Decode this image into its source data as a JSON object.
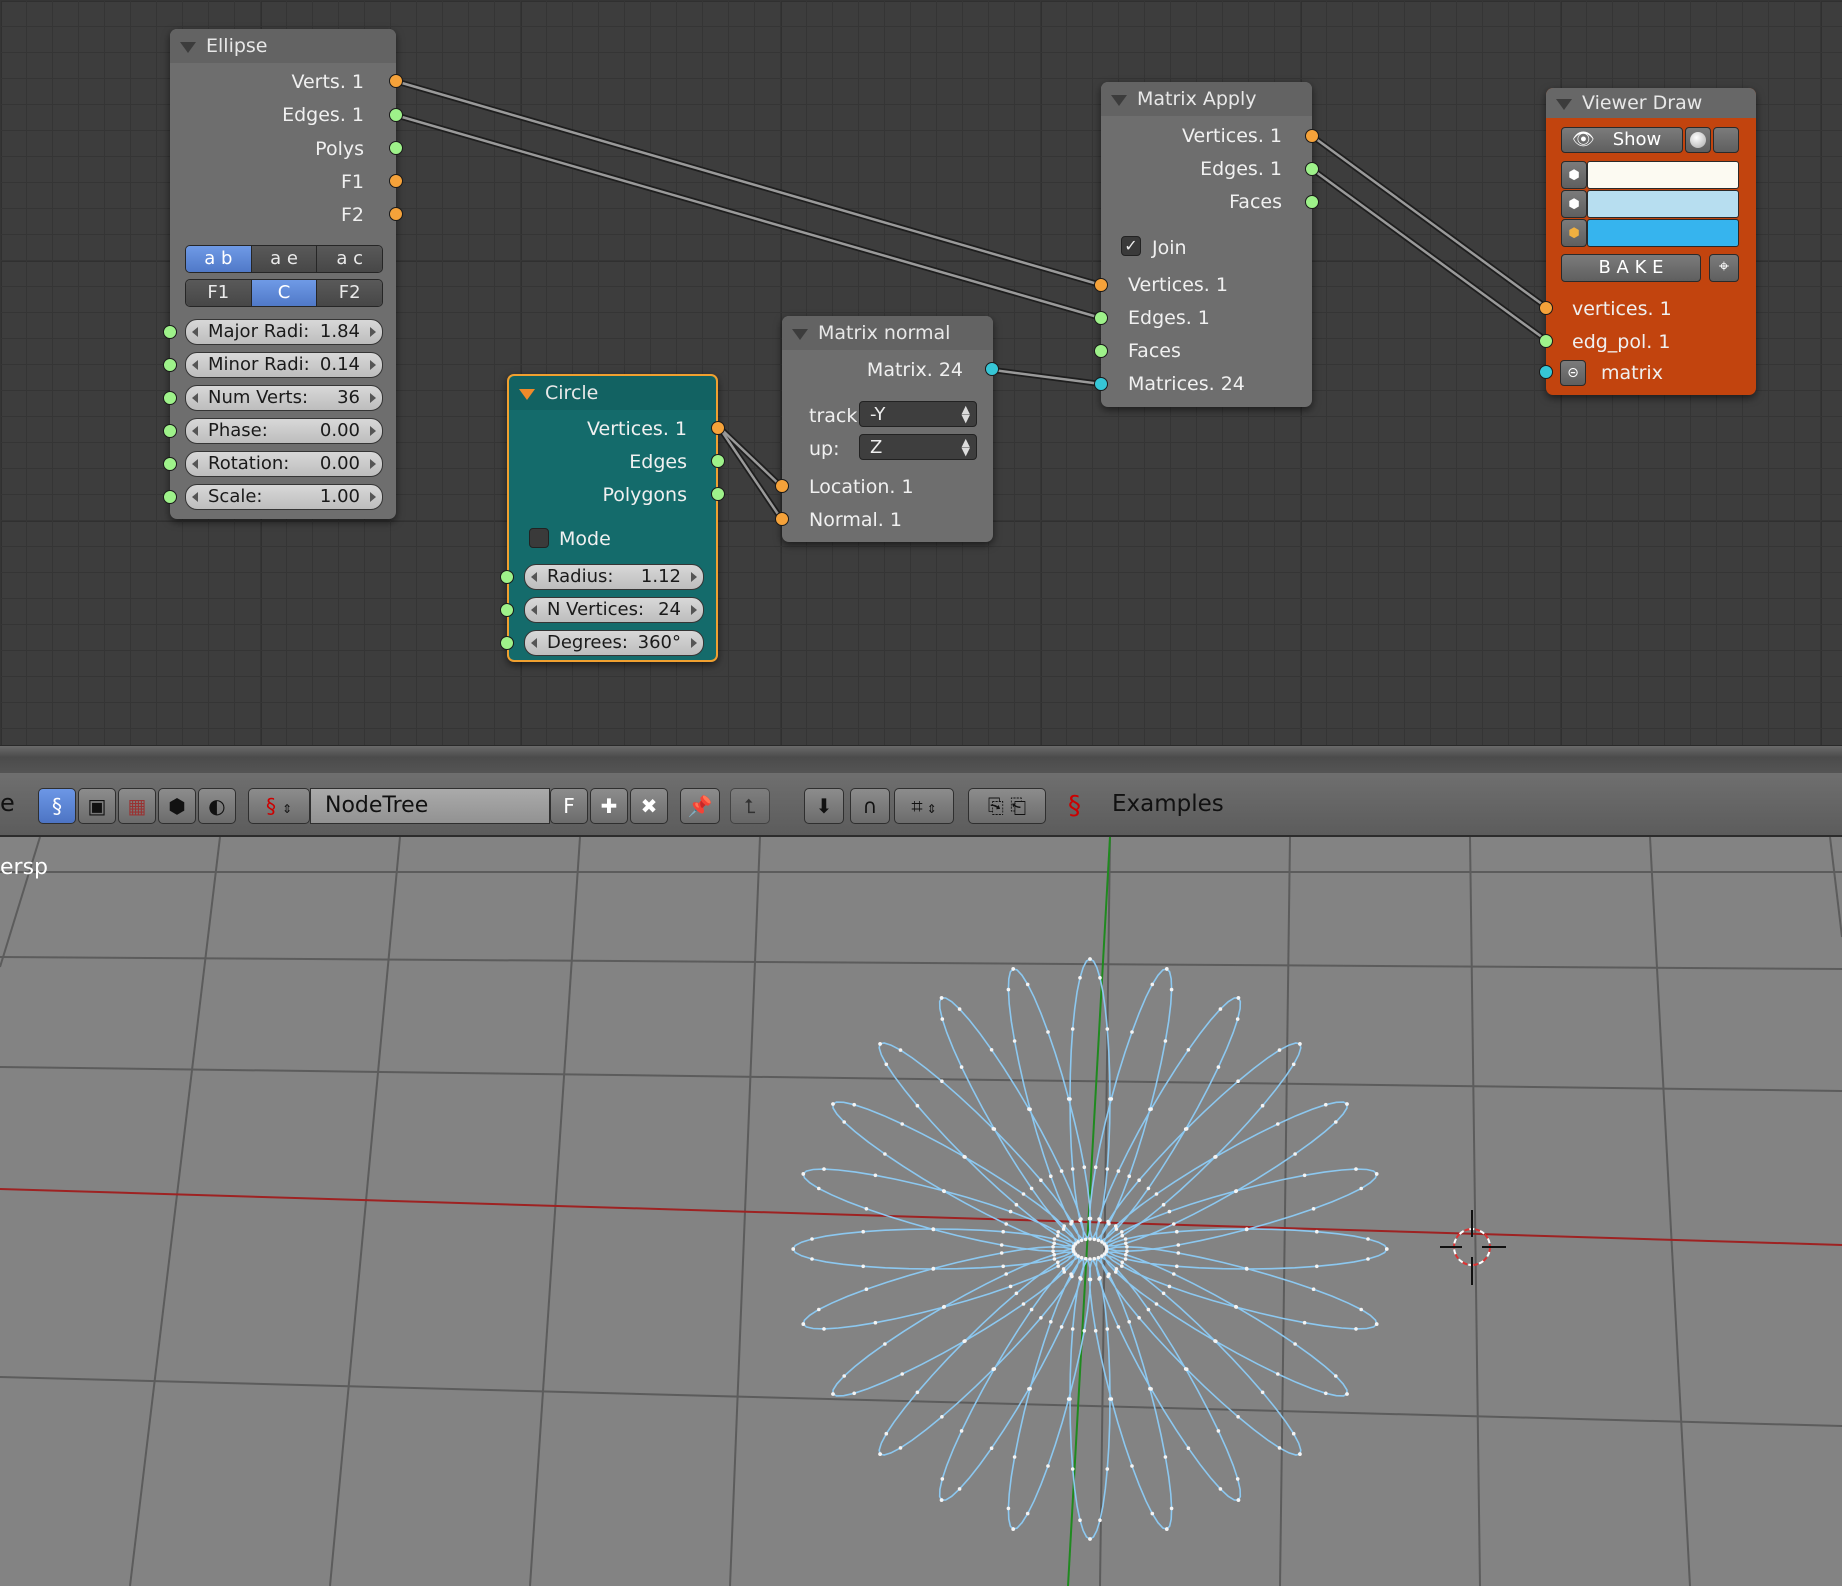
{
  "colors": {
    "socket_orange": "#f5a23a",
    "socket_green": "#9ef28a",
    "socket_cyan": "#36c6d6",
    "circle_node": "#146b6b",
    "viewer_node": "#c2440e",
    "wire": "#8cc8f0",
    "x_axis": "#9e2222",
    "y_axis": "#1f8a1f"
  },
  "ellipse": {
    "title": "Ellipse",
    "outputs": [
      "Verts. 1",
      "Edges. 1",
      "Polys",
      "F1",
      "F2"
    ],
    "mode_buttons": [
      "a b",
      "a e",
      "a c"
    ],
    "centering_buttons": [
      "F1",
      "C",
      "F2"
    ],
    "fields": [
      {
        "label": "Major Radi:",
        "value": "1.84"
      },
      {
        "label": "Minor Radi:",
        "value": "0.14"
      },
      {
        "label": "Num Verts:",
        "value": "36"
      },
      {
        "label": "Phase:",
        "value": "0.00"
      },
      {
        "label": "Rotation:",
        "value": "0.00"
      },
      {
        "label": "Scale:",
        "value": "1.00"
      }
    ]
  },
  "circle": {
    "title": "Circle",
    "outputs": [
      "Vertices. 1",
      "Edges",
      "Polygons"
    ],
    "mode_label": "Mode",
    "fields": [
      {
        "label": "Radius:",
        "value": "1.12"
      },
      {
        "label": "N Vertices:",
        "value": "24"
      },
      {
        "label": "Degrees:",
        "value": "360°"
      }
    ]
  },
  "matrix_normal": {
    "title": "Matrix normal",
    "output": "Matrix. 24",
    "track_label": "track:",
    "track_value": "-Y",
    "up_label": "up:",
    "up_value": "Z",
    "inputs": [
      "Location. 1",
      "Normal. 1"
    ]
  },
  "matrix_apply": {
    "title": "Matrix Apply",
    "outputs": [
      "Vertices. 1",
      "Edges. 1",
      "Faces"
    ],
    "join_label": "Join",
    "inputs": [
      "Vertices. 1",
      "Edges. 1",
      "Faces",
      "Matrices. 24"
    ]
  },
  "viewer_draw": {
    "title": "Viewer Draw",
    "show_label": "Show",
    "bake_label": "B A K E",
    "color_swatches": [
      "#fcfaf2",
      "#b7def0",
      "#36b4ee"
    ],
    "inputs": [
      "vertices. 1",
      "edg_pol. 1",
      "matrix"
    ]
  },
  "toolbar": {
    "left_fragment": "e",
    "tree_name": "NodeTree",
    "fake_user": "F",
    "examples_label": "Examples"
  },
  "viewport": {
    "view_label": "ersp"
  }
}
